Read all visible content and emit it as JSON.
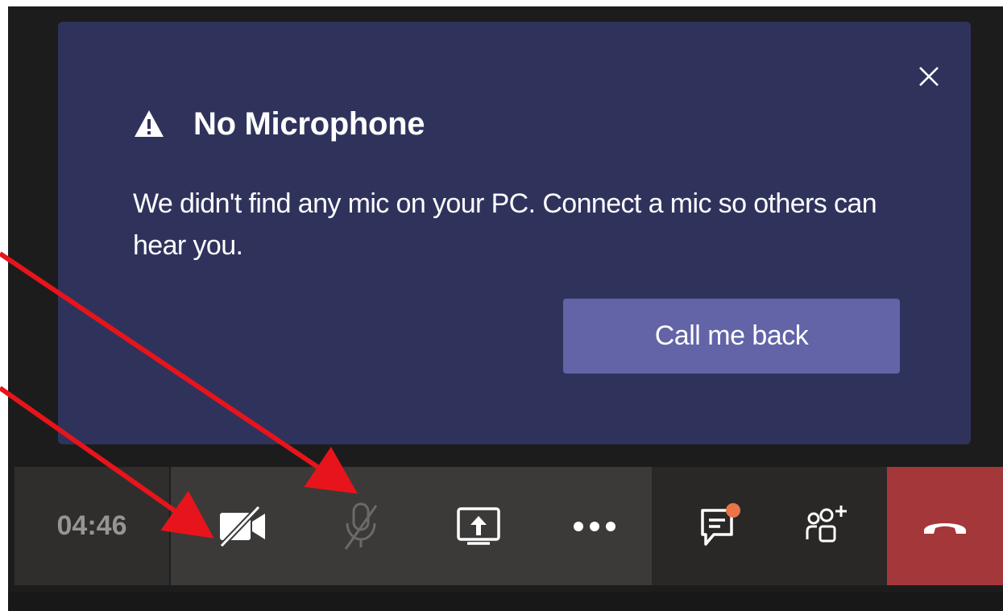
{
  "notification": {
    "title": "No Microphone",
    "message": "We didn't find any mic on your PC. Connect a mic so others can hear you.",
    "action_label": "Call me back",
    "icons": {
      "warning": "warning-triangle-icon",
      "close": "close-icon"
    }
  },
  "call_controls": {
    "timer": "04:46",
    "buttons": [
      {
        "name": "camera-off-button",
        "icon": "video-off-icon",
        "state": "off"
      },
      {
        "name": "mic-disabled-button",
        "icon": "mic-off-icon",
        "state": "disabled"
      },
      {
        "name": "share-screen-button",
        "icon": "share-screen-icon"
      },
      {
        "name": "more-actions-button",
        "icon": "more-dots-icon"
      },
      {
        "name": "chat-button",
        "icon": "chat-icon",
        "has_notification": true
      },
      {
        "name": "participants-button",
        "icon": "add-people-icon"
      },
      {
        "name": "hang-up-button",
        "icon": "phone-hangup-icon"
      }
    ]
  },
  "colors": {
    "notification_bg": "#2f335c",
    "primary_button": "#6264a7",
    "toolbar": "#3b3a39",
    "hang_up": "#a4373a",
    "chat_badge": "#e97548",
    "annotation_arrow": "#e8141b"
  }
}
